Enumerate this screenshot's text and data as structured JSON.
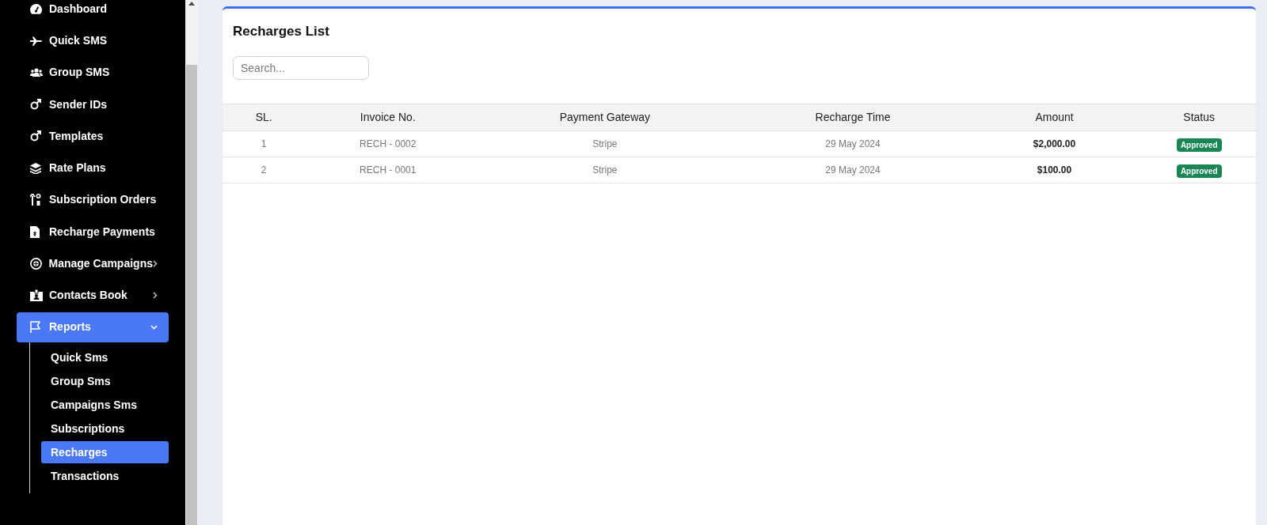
{
  "sidebar": {
    "items": [
      {
        "label": "Dashboard",
        "selected": false
      },
      {
        "label": "Quick SMS",
        "selected": false
      },
      {
        "label": "Group SMS",
        "selected": false
      },
      {
        "label": "Sender IDs",
        "selected": false
      },
      {
        "label": "Templates",
        "selected": false
      },
      {
        "label": "Rate Plans",
        "selected": false
      },
      {
        "label": "Subscription Orders",
        "selected": false
      },
      {
        "label": "Recharge Payments",
        "selected": false
      },
      {
        "label": "Manage Campaigns",
        "selected": false,
        "expanded": false
      },
      {
        "label": "Contacts Book",
        "selected": false,
        "expanded": false
      },
      {
        "label": "Reports",
        "selected": true,
        "expanded": true,
        "children": [
          {
            "label": "Quick Sms",
            "selected": false
          },
          {
            "label": "Group Sms",
            "selected": false
          },
          {
            "label": "Campaigns Sms",
            "selected": false
          },
          {
            "label": "Subscriptions",
            "selected": false
          },
          {
            "label": "Recharges",
            "selected": true
          },
          {
            "label": "Transactions",
            "selected": false
          }
        ]
      }
    ]
  },
  "card": {
    "title": "Recharges List",
    "search": {
      "placeholder": "Search..."
    },
    "table": {
      "columns": [
        "SL.",
        "Invoice No.",
        "Payment Gateway",
        "Recharge Time",
        "Amount",
        "Status"
      ],
      "rows": [
        {
          "sl": "1",
          "invoice": "RECH - 0002",
          "gateway": "Stripe",
          "time": "29 May 2024",
          "amount": "$2,000.00",
          "status": {
            "kind": "approved",
            "label": "Approved"
          }
        },
        {
          "sl": "2",
          "invoice": "RECH - 0001",
          "gateway": "Stripe",
          "time": "29 May 2024",
          "amount": "$100.00",
          "status": {
            "kind": "approved",
            "label": "Approved"
          }
        }
      ]
    }
  }
}
